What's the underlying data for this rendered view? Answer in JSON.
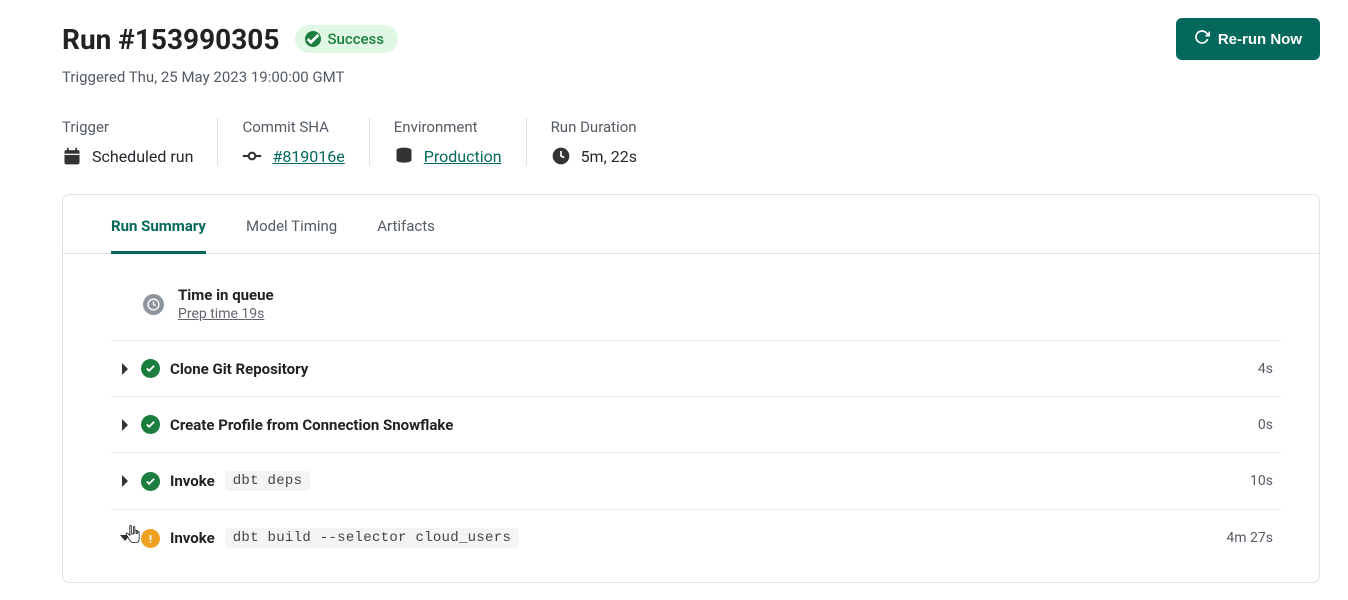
{
  "header": {
    "run_title": "Run #153990305",
    "status_label": "Success",
    "rerun_label": "Re-run Now",
    "triggered_text": "Triggered Thu, 25 May 2023 19:00:00 GMT"
  },
  "meta": {
    "trigger": {
      "label": "Trigger",
      "value": "Scheduled run"
    },
    "commit": {
      "label": "Commit SHA",
      "value": "#819016e"
    },
    "environment": {
      "label": "Environment",
      "value": "Production"
    },
    "duration": {
      "label": "Run Duration",
      "value": "5m, 22s"
    }
  },
  "tabs": {
    "run_summary": "Run Summary",
    "model_timing": "Model Timing",
    "artifacts": "Artifacts"
  },
  "queue": {
    "title": "Time in queue",
    "subtitle": "Prep time 19s"
  },
  "steps": [
    {
      "status": "success",
      "expanded": false,
      "invoke": false,
      "name": "Clone Git Repository",
      "code": "",
      "duration": "4s"
    },
    {
      "status": "success",
      "expanded": false,
      "invoke": false,
      "name": "Create Profile from Connection Snowflake",
      "code": "",
      "duration": "0s"
    },
    {
      "status": "success",
      "expanded": false,
      "invoke": true,
      "name": "Invoke",
      "code": "dbt deps",
      "duration": "10s"
    },
    {
      "status": "warning",
      "expanded": true,
      "invoke": true,
      "name": "Invoke",
      "code": "dbt build --selector cloud_users",
      "duration": "4m 27s"
    }
  ]
}
